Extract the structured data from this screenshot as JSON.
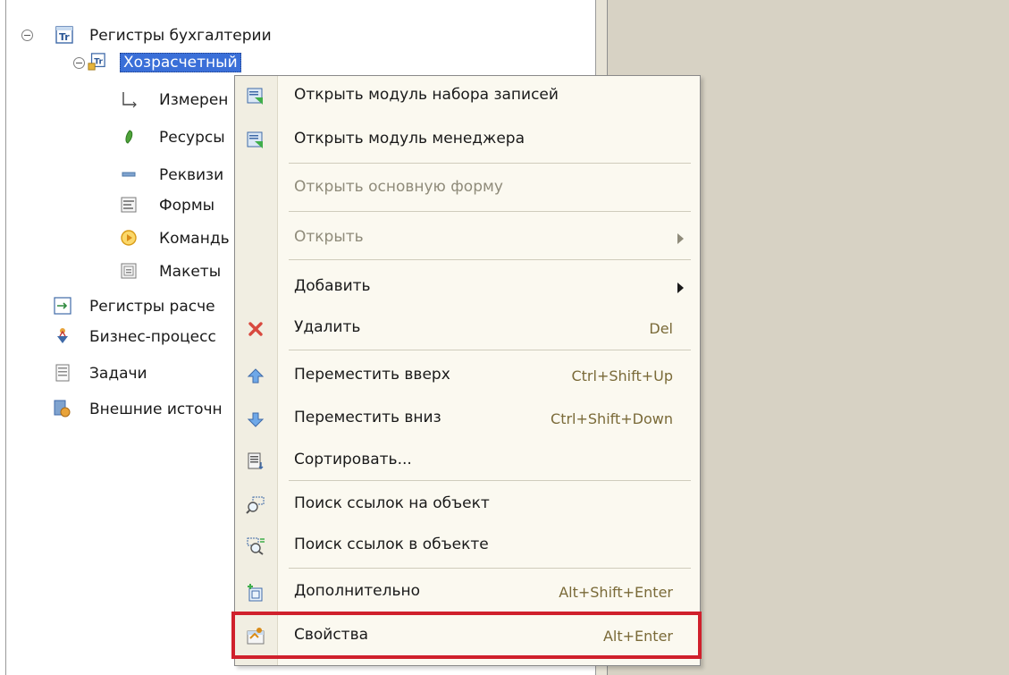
{
  "tree": {
    "items": [
      {
        "label": "Регистры бухгалтерии"
      },
      {
        "label": "Хозрасчетный"
      },
      {
        "label": "Измерен"
      },
      {
        "label": "Ресурсы"
      },
      {
        "label": "Реквизи"
      },
      {
        "label": "Формы"
      },
      {
        "label": "Командь"
      },
      {
        "label": "Макеты"
      },
      {
        "label": "Регистры расче"
      },
      {
        "label": "Бизнес-процесс"
      },
      {
        "label": "Задачи"
      },
      {
        "label": "Внешние источн"
      }
    ]
  },
  "context_menu": {
    "items": [
      {
        "label": "Открыть модуль набора записей",
        "icon": "module-icon"
      },
      {
        "label": "Открыть модуль менеджера",
        "icon": "module-icon"
      },
      {
        "label": "Открыть основную форму",
        "disabled": true
      },
      {
        "label": "Открыть",
        "disabled": true,
        "submenu": true
      },
      {
        "label": "Добавить",
        "submenu": true
      },
      {
        "label": "Удалить",
        "shortcut": "Del",
        "icon": "delete-icon"
      },
      {
        "label": "Переместить вверх",
        "shortcut": "Ctrl+Shift+Up",
        "icon": "arrow-up-icon"
      },
      {
        "label": "Переместить вниз",
        "shortcut": "Ctrl+Shift+Down",
        "icon": "arrow-down-icon"
      },
      {
        "label": "Сортировать...",
        "icon": "sort-icon"
      },
      {
        "label": "Поиск ссылок на объект",
        "icon": "find-refs-icon"
      },
      {
        "label": "Поиск ссылок в объекте",
        "icon": "find-in-object-icon"
      },
      {
        "label": "Дополнительно",
        "shortcut": "Alt+Shift+Enter",
        "icon": "additional-icon"
      },
      {
        "label": "Свойства",
        "shortcut": "Alt+Enter",
        "icon": "properties-icon"
      }
    ]
  },
  "colors": {
    "highlight": "#d0202c",
    "selection": "#3a6fd8",
    "menu_background": "#fbf9f0",
    "right_panel": "#d7d2c4"
  }
}
